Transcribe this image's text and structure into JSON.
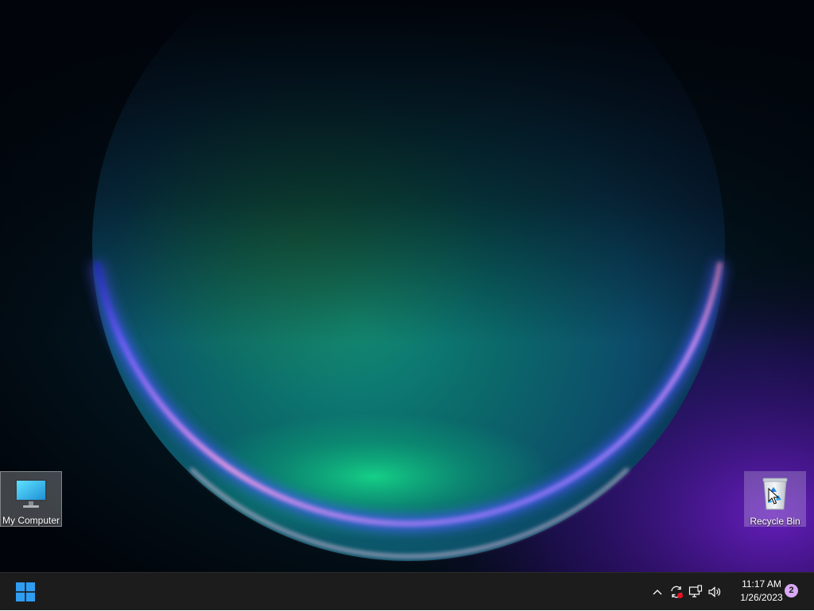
{
  "desktop": {
    "icons": [
      {
        "label": "My Computer",
        "icon": "monitor-icon",
        "state": "selected"
      },
      {
        "label": "Recycle Bin",
        "icon": "recycle-bin-icon",
        "state": "hover"
      }
    ],
    "wallpaper": {
      "colors": [
        "#00d08a",
        "#0a7c8c",
        "#3a4cf0",
        "#f0a8e8",
        "#7a2ad0"
      ]
    }
  },
  "taskbar": {
    "start_icon": "windows-logo-icon",
    "accent": "#0078d4",
    "tray": {
      "icons": [
        "chevron-up-icon",
        "sync-error-icon",
        "network-icon",
        "volume-icon"
      ]
    },
    "clock": {
      "time": "11:17 AM",
      "date": "1/26/2023"
    },
    "notifications": {
      "count": "2"
    }
  }
}
